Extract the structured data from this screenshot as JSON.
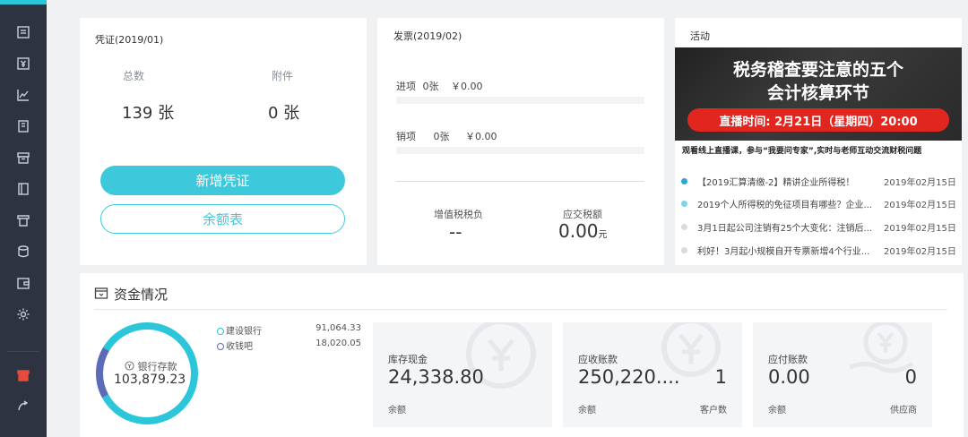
{
  "sidebar": {
    "items": [
      "document-list-icon",
      "yen-receipt-icon",
      "line-chart-icon",
      "building-icon",
      "archive-box-icon",
      "book-icon",
      "shop-icon",
      "coins-stack-icon",
      "wallet-icon",
      "settings-gear-icon"
    ],
    "bottom": [
      "gift-box-icon",
      "logout-icon"
    ],
    "accent": "#2bc6d9"
  },
  "voucher": {
    "title": "凭证(2019/01)",
    "total_label": "总数",
    "total_value": "139 张",
    "attach_label": "附件",
    "attach_value": "0 张",
    "new_button": "新增凭证",
    "balance_button": "余额表"
  },
  "invoice": {
    "title": "发票(2019/02)",
    "incoming_label": "进项",
    "incoming_count": "0张",
    "incoming_amount": "￥0.00",
    "outgoing_label": "销项",
    "outgoing_count": "0张",
    "outgoing_amount": "￥0.00",
    "vat_label": "增值税税负",
    "vat_value": "--",
    "payable_label": "应交税额",
    "payable_value": "0.00",
    "payable_unit": "元"
  },
  "activity": {
    "title": "活动",
    "banner_line1": "税务稽查要注意的五个",
    "banner_line2": "会计核算环节",
    "banner_pill": "直播时间: 2月21日（星期四）20:00",
    "banner_sub": "观看线上直播课，参与“我要问专家”,实时与老师互动交流财税问题",
    "news": [
      {
        "title": "【2019汇算清缴-2】精讲企业所得税！",
        "date": "2019年02月15日",
        "color": "#2ba6d9"
      },
      {
        "title": "2019个人所得税的免征项目有哪些？企业...",
        "date": "2019年02月15日",
        "color": "#7fd3e6"
      },
      {
        "title": "3月1日起公司注销有25个大变化：注销后...",
        "date": "2019年02月15日",
        "color": "#d8dbe0"
      },
      {
        "title": "利好！3月起小规模自开专票新增4个行业...",
        "date": "2019年02月15日",
        "color": "#d8dbe0"
      }
    ]
  },
  "funds": {
    "title": "资金情况",
    "ring_label": "银行存款",
    "ring_value": "103,879.23",
    "ring_shares": [
      0.8353,
      0.1647
    ],
    "ring_colors": [
      "#2bc6d9",
      "#5b6bb8"
    ],
    "legend": [
      {
        "name": "建设银行",
        "value": "91,064.33"
      },
      {
        "name": "收钱吧",
        "value": "18,020.05"
      }
    ],
    "cards": [
      {
        "title": "库存现金",
        "value": "24,338.80",
        "sub": "余额",
        "count": "",
        "count_label": ""
      },
      {
        "title": "应收账款",
        "value": "250,220....",
        "sub": "余额",
        "count": "1",
        "count_label": "客户数"
      },
      {
        "title": "应付账款",
        "value": "0.00",
        "sub": "余额",
        "count": "0",
        "count_label": "供应商"
      }
    ]
  }
}
